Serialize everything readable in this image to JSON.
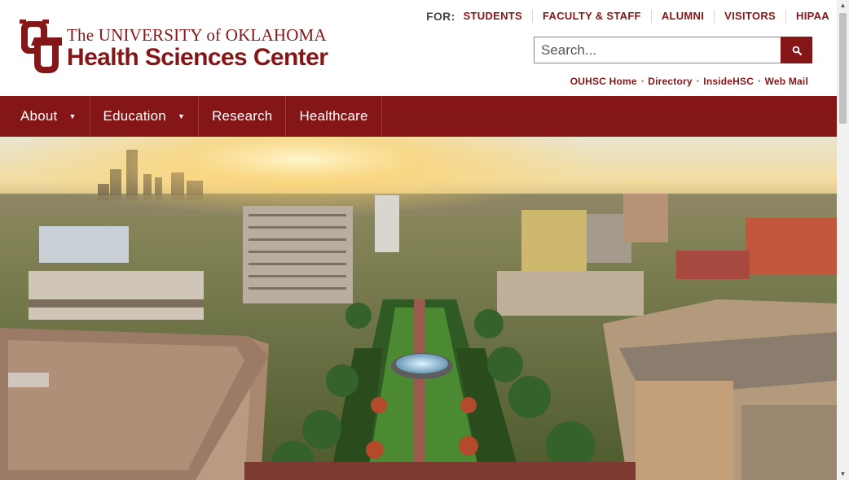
{
  "brand": {
    "line1": "The UNIVERSITY of OKLAHOMA",
    "line2": "Health Sciences Center",
    "color": "#841617"
  },
  "audience_nav": {
    "label": "FOR:",
    "links": [
      "STUDENTS",
      "FACULTY & STAFF",
      "ALUMNI",
      "VISITORS",
      "HIPAA"
    ]
  },
  "search": {
    "placeholder": "Search...",
    "value": "",
    "button_icon": "search-icon"
  },
  "utility_links": [
    "OUHSC Home",
    "Directory",
    "InsideHSC",
    "Web Mail"
  ],
  "utility_separator": "•",
  "main_nav": {
    "items": [
      {
        "label": "About",
        "has_dropdown": true
      },
      {
        "label": "Education",
        "has_dropdown": true
      },
      {
        "label": "Research",
        "has_dropdown": false
      },
      {
        "label": "Healthcare",
        "has_dropdown": false
      }
    ],
    "dropdown_icon": "▼",
    "background": "#841617"
  },
  "hero": {
    "image": "aerial-campus-photo"
  },
  "scrollbar": {
    "up_icon": "▲",
    "down_icon": "▼"
  }
}
